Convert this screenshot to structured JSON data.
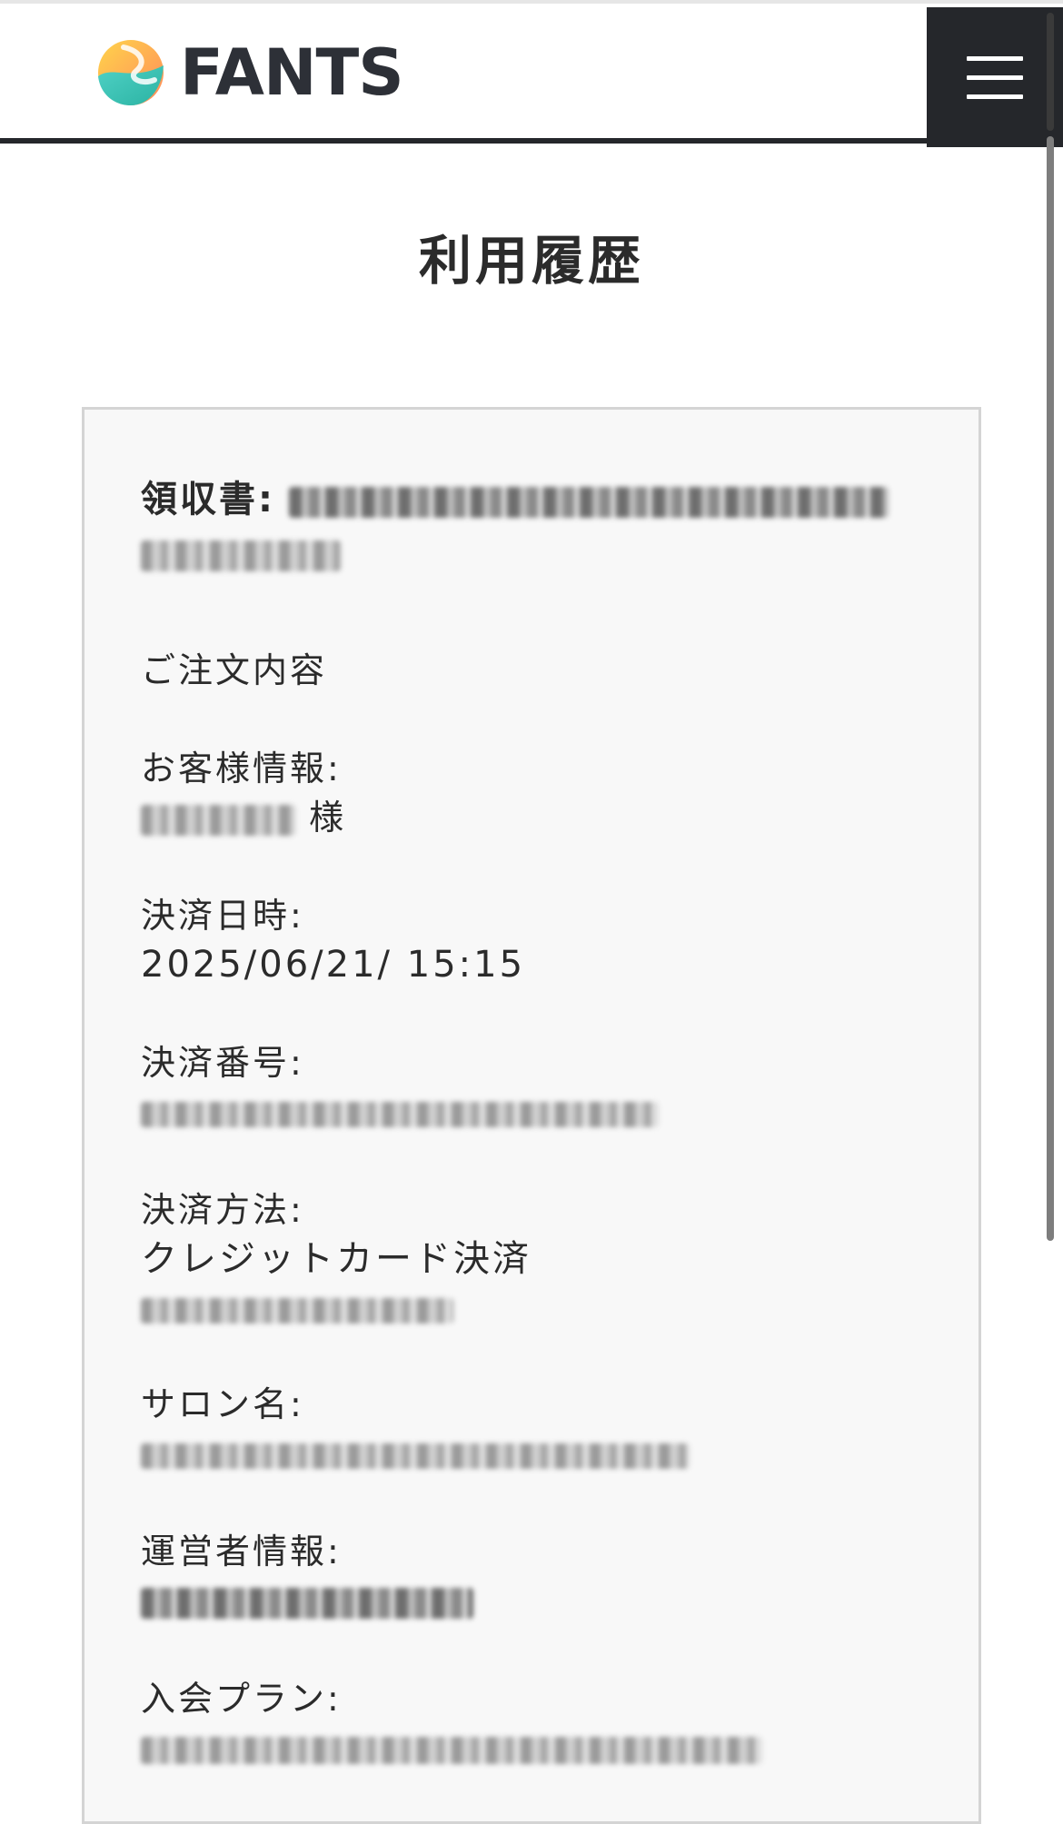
{
  "header": {
    "logo_text": "FANTS",
    "menu_icon": "hamburger-menu-icon"
  },
  "page": {
    "title": "利用履歴"
  },
  "receipt": {
    "receipt_label": "領収書:",
    "order_details_heading": "ご注文内容",
    "customer_label": "お客様情報:",
    "customer_suffix": "様",
    "payment_datetime_label": "決済日時:",
    "payment_datetime_value": "2025/06/21/ 15:15",
    "payment_number_label": "決済番号:",
    "payment_method_label": "決済方法:",
    "payment_method_value": "クレジットカード決済",
    "salon_name_label": "サロン名:",
    "operator_info_label": "運営者情報:",
    "membership_plan_label": "入会プラン:"
  },
  "colors": {
    "header_dark": "#25272b",
    "card_background": "#f8f8f8",
    "card_border": "#d4d4d4",
    "text": "#2b2b2b"
  }
}
